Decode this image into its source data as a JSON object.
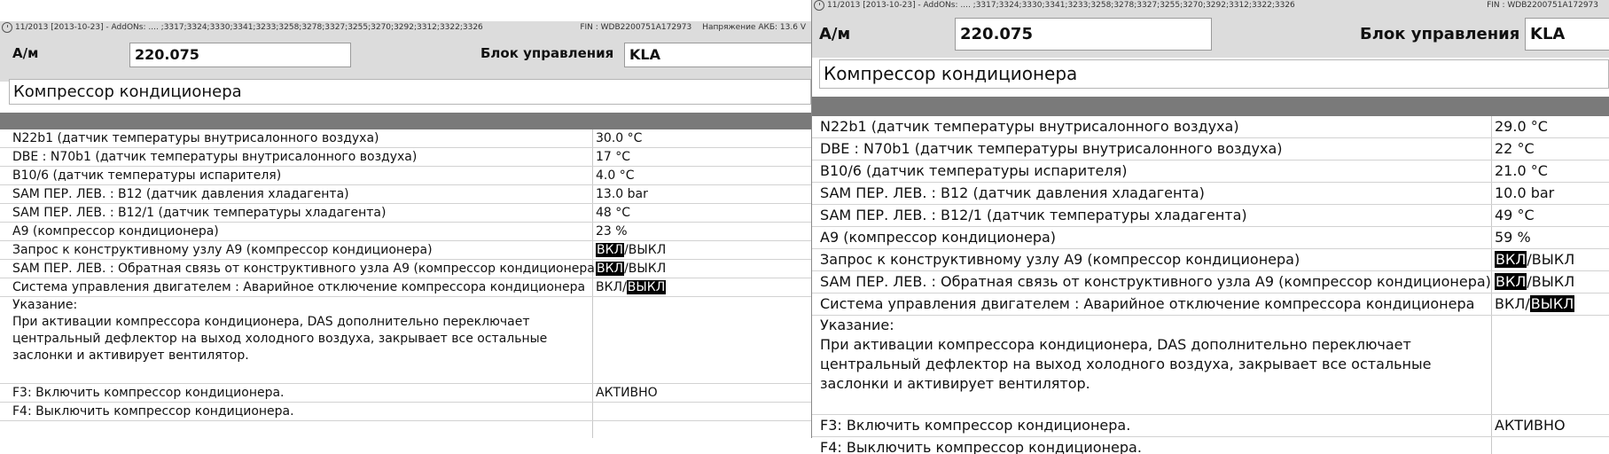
{
  "left": {
    "status": {
      "left_text": "11/2013 [2013-10-23] - AddONs: .... ;3317;3324;3330;3341;3233;3258;3278;3327;3255;3270;3292;3312;3322;3326",
      "fin": "FIN : WDB2200751A172973",
      "voltage": "Напряжение АКБ: 13.6 V"
    },
    "header": {
      "am_label": "А/м",
      "am_value": "220.075",
      "ecu_label": "Блок управления",
      "ecu_value": "KLA"
    },
    "title": "Компрессор кондиционера",
    "rows": [
      {
        "label": "N22b1 (датчик температуры внутрисалонного воздуха)",
        "value": "30.0 °C"
      },
      {
        "label": "DBE : N70b1 (датчик температуры внутрисалонного воздуха)",
        "value": " 17 °C"
      },
      {
        "label": "B10/6 (датчик температуры испарителя)",
        "value": "4.0 °C"
      },
      {
        "label": "SAM ПЕР. ЛЕВ. : B12 (датчик давления хладагента)",
        "value": "13.0 bar"
      },
      {
        "label": "SAM ПЕР. ЛЕВ. : B12/1 (датчик температуры хладагента)",
        "value": " 48 °C"
      },
      {
        "label": "A9 (компрессор кондиционера)",
        "value": " 23 %"
      },
      {
        "label": "Запрос к конструктивному узлу A9 (компрессор кондиционера)",
        "on": "ВКЛ",
        "off": "ВЫКЛ",
        "active": "on"
      },
      {
        "label": "SAM ПЕР. ЛЕВ. : Обратная связь от конструктивного узла A9 (компрессор кондиционера)",
        "on": "ВКЛ",
        "off": "ВЫКЛ",
        "active": "on"
      },
      {
        "label": "Система управления двигателем : Аварийное отключение компрессора кондиционера",
        "on": "ВКЛ",
        "off": "ВЫКЛ",
        "active": "off"
      }
    ],
    "note_label": "Указание:",
    "note_text": "При активации компрессора кондиционера, DAS дополнительно переключает центральный дефлектор на выход холодного воздуха, закрывает все остальные заслонки и активирует вентилятор.",
    "f3_label": "F3: Включить компрессор кондиционера.",
    "f3_value": "АКТИВНО",
    "f4_label": "F4: Выключить компрессор кондиционера."
  },
  "right": {
    "status": {
      "left_text": "11/2013 [2013-10-23] - AddONs: .... ;3317;3324;3330;3341;3233;3258;3278;3327;3255;3270;3292;3312;3322;3326",
      "fin": "FIN : WDB2200751A172973"
    },
    "header": {
      "am_label": "А/м",
      "am_value": "220.075",
      "ecu_label": "Блок управления",
      "ecu_value": "KLA"
    },
    "title": "Компрессор кондиционера",
    "rows": [
      {
        "label": "N22b1 (датчик температуры внутрисалонного воздуха)",
        "value": "29.0 °C"
      },
      {
        "label": "DBE : N70b1 (датчик температуры внутрисалонного воздуха)",
        "value": " 22 °C"
      },
      {
        "label": "B10/6 (датчик температуры испарителя)",
        "value": "21.0 °C"
      },
      {
        "label": "SAM ПЕР. ЛЕВ. : B12 (датчик давления хладагента)",
        "value": "10.0 bar"
      },
      {
        "label": "SAM ПЕР. ЛЕВ. : B12/1 (датчик температуры хладагента)",
        "value": " 49 °C"
      },
      {
        "label": "A9 (компрессор кондиционера)",
        "value": " 59 %"
      },
      {
        "label": "Запрос к конструктивному узлу A9 (компрессор кондиционера)",
        "on": "ВКЛ",
        "off": "ВЫКЛ",
        "active": "on"
      },
      {
        "label": "SAM ПЕР. ЛЕВ. : Обратная связь от конструктивного узла A9 (компрессор кондиционера)",
        "on": "ВКЛ",
        "off": "ВЫКЛ",
        "active": "on"
      },
      {
        "label": "Система управления двигателем : Аварийное отключение компрессора кондиционера",
        "on": "ВКЛ",
        "off": "ВЫКЛ",
        "active": "off"
      }
    ],
    "note_label": "Указание:",
    "note_text": "При активации компрессора кондиционера, DAS дополнительно переключает центральный дефлектор на выход холодного воздуха, закрывает все остальные заслонки и активирует вентилятор.",
    "f3_label": "F3: Включить компрессор кондиционера.",
    "f3_value": "АКТИВНО",
    "f4_label": "F4: Выключить компрессор кондиционера."
  }
}
